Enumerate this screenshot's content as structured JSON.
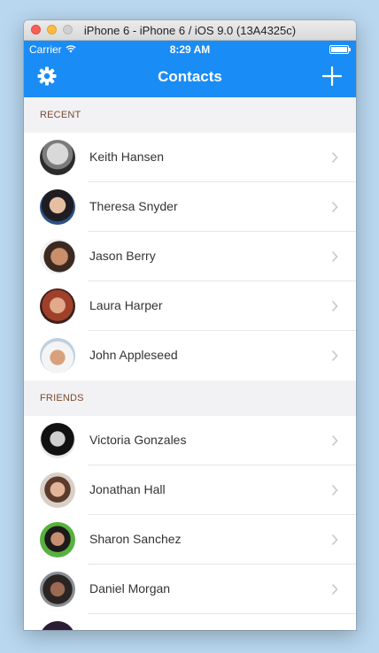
{
  "window": {
    "title": "iPhone 6 - iPhone 6 / iOS 9.0 (13A4325c)"
  },
  "status_bar": {
    "carrier": "Carrier",
    "time": "8:29 AM",
    "battery_icon": "battery-icon",
    "wifi_icon": "wifi-icon"
  },
  "nav": {
    "title": "Contacts",
    "left_icon": "gear-icon",
    "right_icon": "plus-icon"
  },
  "colors": {
    "accent": "#1a8cf5",
    "section_bg": "#f2f2f5",
    "section_text": "#7a4a2d"
  },
  "sections": [
    {
      "title": "RECENT",
      "contacts": [
        {
          "name": "Keith Hansen"
        },
        {
          "name": "Theresa Snyder"
        },
        {
          "name": "Jason Berry"
        },
        {
          "name": "Laura Harper"
        },
        {
          "name": "John Appleseed"
        }
      ]
    },
    {
      "title": "FRIENDS",
      "contacts": [
        {
          "name": "Victoria Gonzales"
        },
        {
          "name": "Jonathan Hall"
        },
        {
          "name": "Sharon Sanchez"
        },
        {
          "name": "Daniel Morgan"
        },
        {
          "name": ""
        }
      ]
    }
  ]
}
